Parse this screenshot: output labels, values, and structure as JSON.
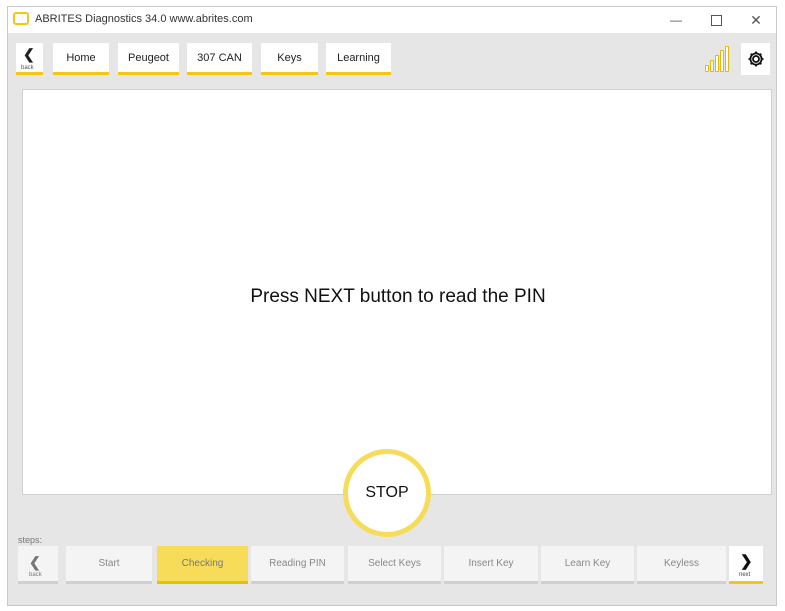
{
  "window": {
    "title": "ABRITES Diagnostics 34.0   www.abrites.com",
    "minimize_icon": "minimize-icon",
    "maximize_icon": "maximize-icon",
    "close_icon": "close-icon"
  },
  "nav": {
    "back_label": "back",
    "breadcrumbs": [
      "Home",
      "Peugeot",
      "307 CAN",
      "Keys",
      "Learning"
    ],
    "signal_icon": "signal-strength-icon",
    "settings_icon": "gear-icon"
  },
  "main": {
    "message": "Press NEXT button to read the PIN",
    "stop_label": "STOP"
  },
  "steps": {
    "label": "steps:",
    "back_label": "back",
    "next_label": "next",
    "items": [
      "Start",
      "Checking",
      "Reading PIN",
      "Select Keys",
      "Insert Key",
      "Learn Key",
      "Keyless"
    ],
    "active": "Checking"
  },
  "colors": {
    "accent": "#f5c518",
    "active_step": "#f7dc5a",
    "background": "#e6e6e6"
  }
}
